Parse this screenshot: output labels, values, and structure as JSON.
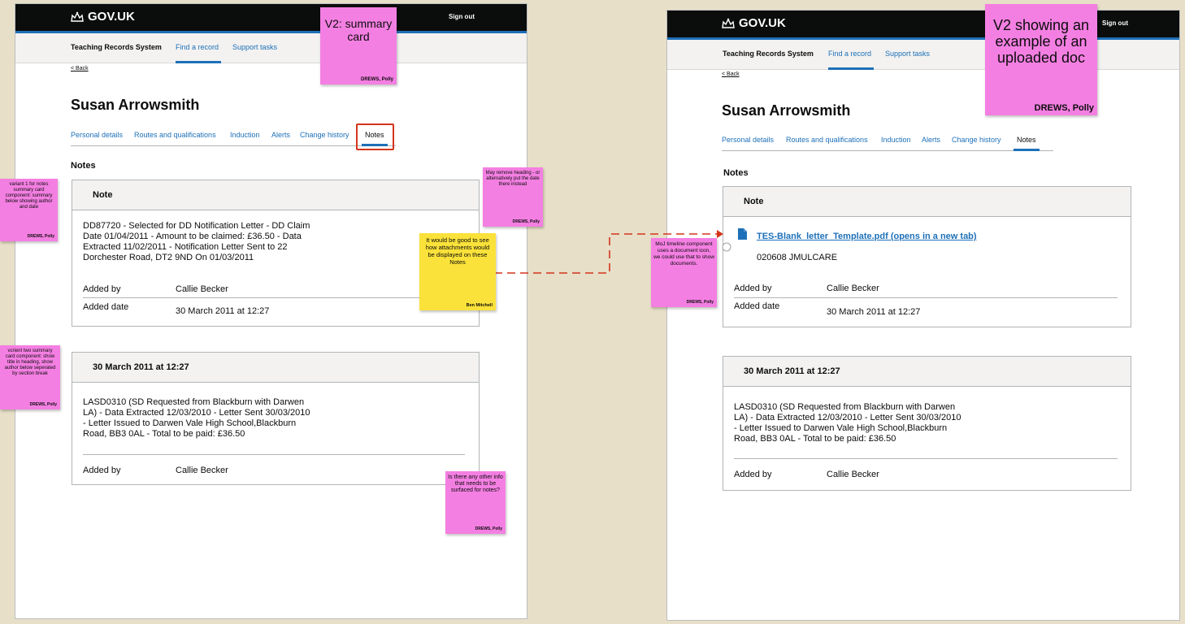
{
  "govuk_logo": "GOV.UK",
  "sign_out": "Sign out",
  "service_name": "Teaching Records System",
  "nav_links": [
    "Find a record",
    "Support tasks"
  ],
  "back": "Back",
  "person_name": "Susan Arrowsmith",
  "tabs": [
    "Personal details",
    "Routes and qualifications",
    "Induction",
    "Alerts",
    "Change history",
    "Notes"
  ],
  "active_tab": "Notes",
  "section_title": "Notes",
  "left_card1": {
    "title": "Note",
    "text": "DD87720 - Selected for DD Notification Letter - DD Claim\nDate 01/04/2011 - Amount to be claimed: £36.50 - Data\nExtracted 11/02/2011 - Notification Letter Sent to 22\nDorchester Road, DT2 9ND On 01/03/2011",
    "added_by_label": "Added by",
    "added_by": "Callie Becker",
    "added_date_label": "Added date",
    "added_date": "30 March 2011 at 12:27"
  },
  "card2": {
    "title": "30 March 2011 at 12:27",
    "text": "LASD0310 (SD Requested from Blackburn with Darwen\nLA) - Data Extracted 12/03/2010 - Letter Sent 30/03/2010\n- Letter Issued to Darwen Vale High School,Blackburn\nRoad, BB3 0AL - Total to be paid: £36.50",
    "added_by_label": "Added by",
    "added_by": "Callie Becker"
  },
  "right_card1": {
    "title": "Note",
    "doc_link": "TES-Blank_letter_Template.pdf (opens in a new tab)",
    "doc_ref": "020608 JMULCARE",
    "added_by_label": "Added by",
    "added_by": "Callie Becker",
    "added_date_label": "Added date",
    "added_date": "30 March 2011 at 12:27"
  },
  "stickies": {
    "v2_summary": {
      "text": "V2: summary card",
      "author": "DREWS, Polly"
    },
    "variant1": {
      "text": "variant 1 for notes summary card component: summary below showing author and date",
      "author": "DREWS, Polly"
    },
    "variant2": {
      "text": "vcrient two summary card component: show title in heading, show author below seperated by section break",
      "author": "DREWS, Polly"
    },
    "remove_heading": {
      "text": "May remove heading - or alternatively put the date there instead",
      "author": "DREWS, Polly"
    },
    "attachments": {
      "text": "It would be good to see how attachments would be displayed on these Notes",
      "author": "Ben Mitchell"
    },
    "other_info": {
      "text": "Is there any other info that needs to be surfaced for notes?",
      "author": "DREWS, Polly"
    },
    "moj": {
      "text": "MoJ timeline component uses a document icon, we could use that to show documents.",
      "author": "DREWS, Polly"
    },
    "v2_uploaded": {
      "text": "V2 showing an example of an uploaded doc",
      "author": "DREWS, Polly"
    }
  },
  "colors": {
    "header": "#0b0c0c",
    "link": "#1d70b8",
    "sticky_pink": "#f47fe2",
    "sticky_yellow": "#fbe23a",
    "highlight": "#d4351c"
  }
}
